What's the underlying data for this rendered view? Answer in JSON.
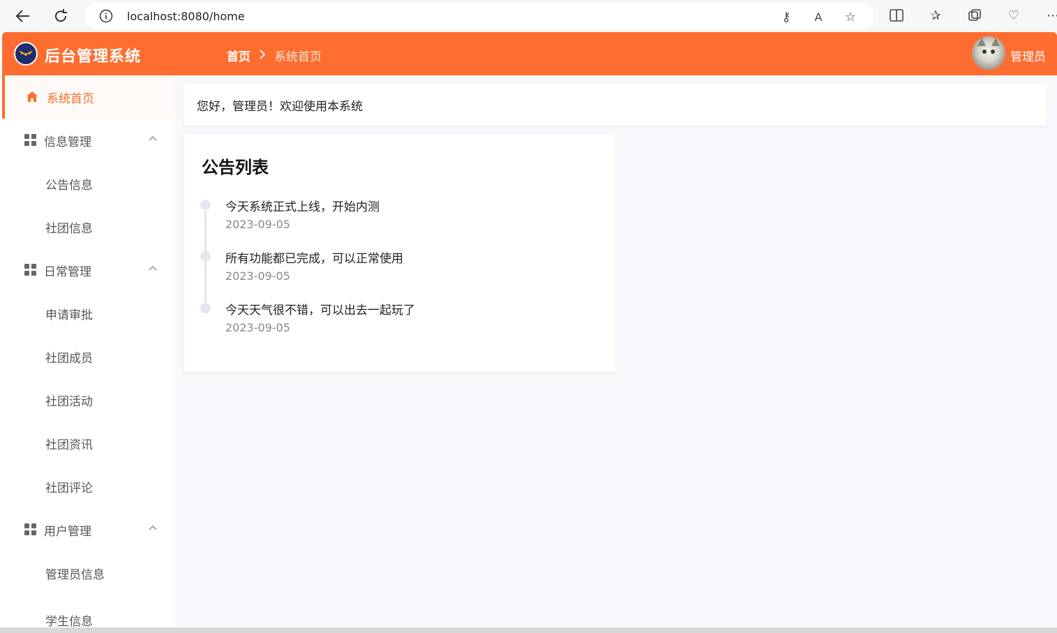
{
  "browser": {
    "url": "localhost:8080/home"
  },
  "header": {
    "brand": "后台管理系统",
    "breadcrumb_home": "首页",
    "breadcrumb_current": "系统首页",
    "user_name": "管理员"
  },
  "sidebar": {
    "items": [
      {
        "label": "系统首页",
        "active": true
      },
      {
        "label": "信息管理",
        "group": true
      },
      {
        "label": "公告信息"
      },
      {
        "label": "社团信息"
      },
      {
        "label": "日常管理",
        "group": true
      },
      {
        "label": "申请审批"
      },
      {
        "label": "社团成员"
      },
      {
        "label": "社团活动"
      },
      {
        "label": "社团资讯"
      },
      {
        "label": "社团评论"
      },
      {
        "label": "用户管理",
        "group": true
      },
      {
        "label": "管理员信息"
      },
      {
        "label": "学生信息"
      }
    ]
  },
  "welcome": {
    "text": "您好，管理员！欢迎使用本系统"
  },
  "notices": {
    "title": "公告列表",
    "items": [
      {
        "content": "今天系统正式上线，开始内测",
        "date": "2023-09-05"
      },
      {
        "content": "所有功能都已完成，可以正常使用",
        "date": "2023-09-05"
      },
      {
        "content": "今天天气很不错，可以出去一起玩了",
        "date": "2023-09-05"
      }
    ]
  },
  "colors": {
    "accent": "#fe6d2f",
    "background": "#f7f8fc"
  }
}
